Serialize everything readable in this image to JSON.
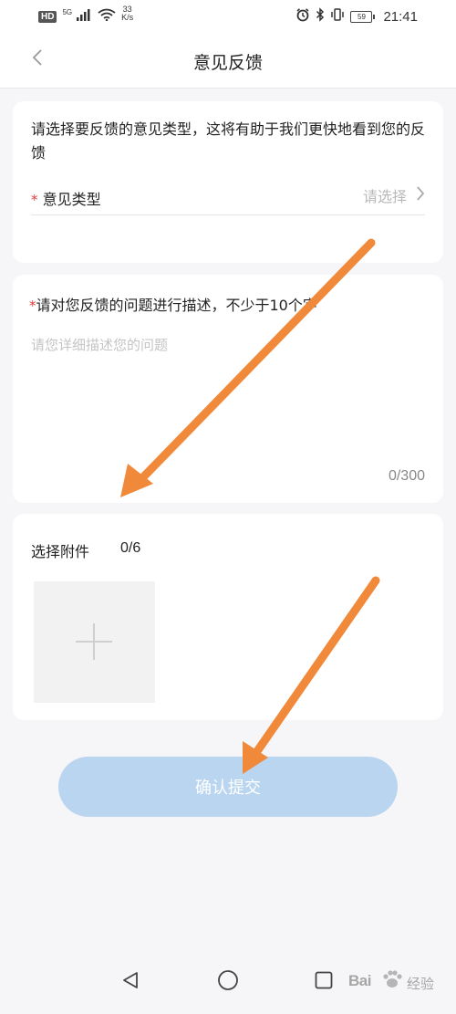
{
  "status_bar": {
    "hd_label": "HD",
    "network_label": "5G",
    "net_speed_value": "33",
    "net_speed_unit": "K/s",
    "battery": "59",
    "time": "21:41",
    "icons": [
      "signal-icon",
      "wifi-icon",
      "alarm-icon",
      "bluetooth-icon",
      "vibrate-icon",
      "battery-icon"
    ]
  },
  "header": {
    "title": "意见反馈",
    "back_icon": "chevron-left-icon"
  },
  "type_section": {
    "hint": "请选择要反馈的意见类型，这将有助于我们更快地看到您的反馈",
    "required_mark": "*",
    "label": "意见类型",
    "placeholder": "请选择",
    "chevron_icon": "chevron-right-icon"
  },
  "description_section": {
    "required_mark": "*",
    "label": "请对您反馈的问题进行描述，不少于10个字",
    "placeholder": "请您详细描述您的问题",
    "value": "",
    "counter": "0/300"
  },
  "attachment_section": {
    "label": "选择附件",
    "count": "0/6",
    "add_icon": "plus-icon"
  },
  "submit": {
    "label": "确认提交"
  },
  "system_nav": {
    "back_icon": "triangle-back-icon",
    "home_icon": "circle-home-icon",
    "recents_icon": "square-recents-icon"
  },
  "watermark": {
    "brand": "Bai",
    "brand_suffix": "经验"
  },
  "colors": {
    "background": "#f6f6f8",
    "card": "#ffffff",
    "required": "#e23b3b",
    "placeholder": "#b8b8b8",
    "submit_bg": "#bad5f0",
    "arrow": "#f0893a"
  }
}
